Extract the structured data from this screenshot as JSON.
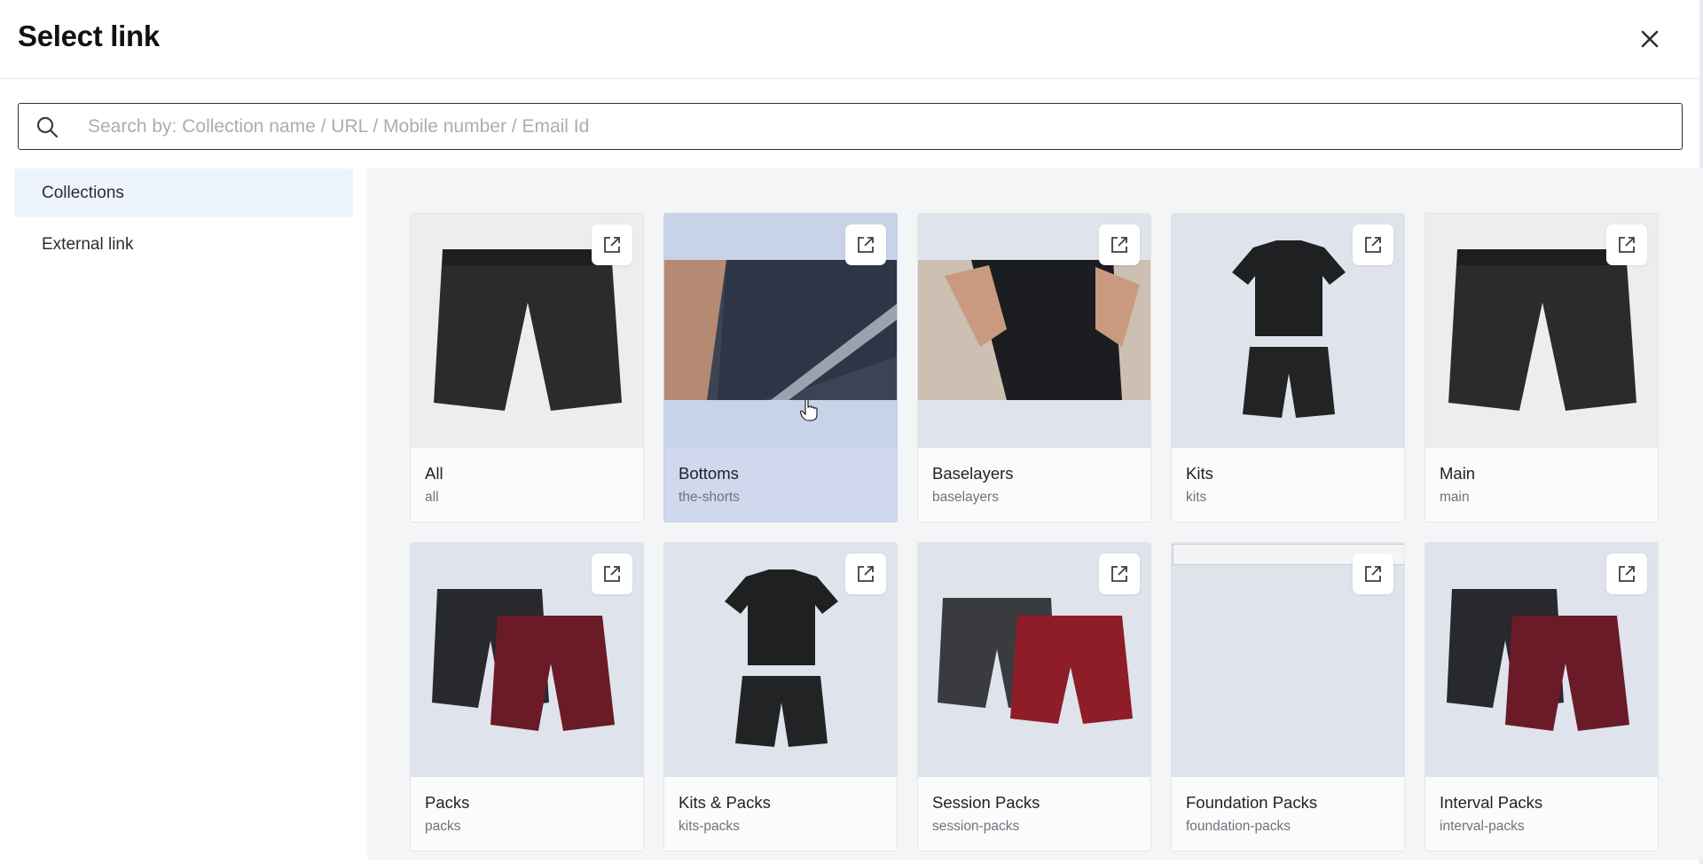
{
  "dialog": {
    "title": "Select link"
  },
  "search": {
    "placeholder": "Search by: Collection name / URL / Mobile number / Email Id",
    "value": ""
  },
  "sidebar": {
    "items": [
      {
        "label": "Collections",
        "active": true
      },
      {
        "label": "External link",
        "active": false
      }
    ]
  },
  "collections": [
    {
      "title": "All",
      "slug": "all",
      "image": "black-shorts"
    },
    {
      "title": "Bottoms",
      "slug": "the-shorts",
      "image": "athlete-shorts-barbell"
    },
    {
      "title": "Baselayers",
      "slug": "baselayers",
      "image": "baselayer-tights-phone"
    },
    {
      "title": "Kits",
      "slug": "kits",
      "image": "tee-and-shorts"
    },
    {
      "title": "Main",
      "slug": "main",
      "image": "black-shorts"
    },
    {
      "title": "Packs",
      "slug": "packs",
      "image": "two-shorts-black-maroon"
    },
    {
      "title": "Kits & Packs",
      "slug": "kits-packs",
      "image": "tee-and-shorts"
    },
    {
      "title": "Session Packs",
      "slug": "session-packs",
      "image": "two-shorts-grey-red"
    },
    {
      "title": "Foundation Packs",
      "slug": "foundation-packs",
      "image": "broken-image"
    },
    {
      "title": "Interval Packs",
      "slug": "interval-packs",
      "image": "two-shorts-black-maroon"
    }
  ],
  "icons": {
    "close": "close-icon",
    "search": "search-icon",
    "external": "open-in-new-icon"
  },
  "colors": {
    "sidebar_active_bg": "#edf4fd",
    "content_bg": "#f4f5f7",
    "card_hover_bg": "#cfd8ec"
  }
}
